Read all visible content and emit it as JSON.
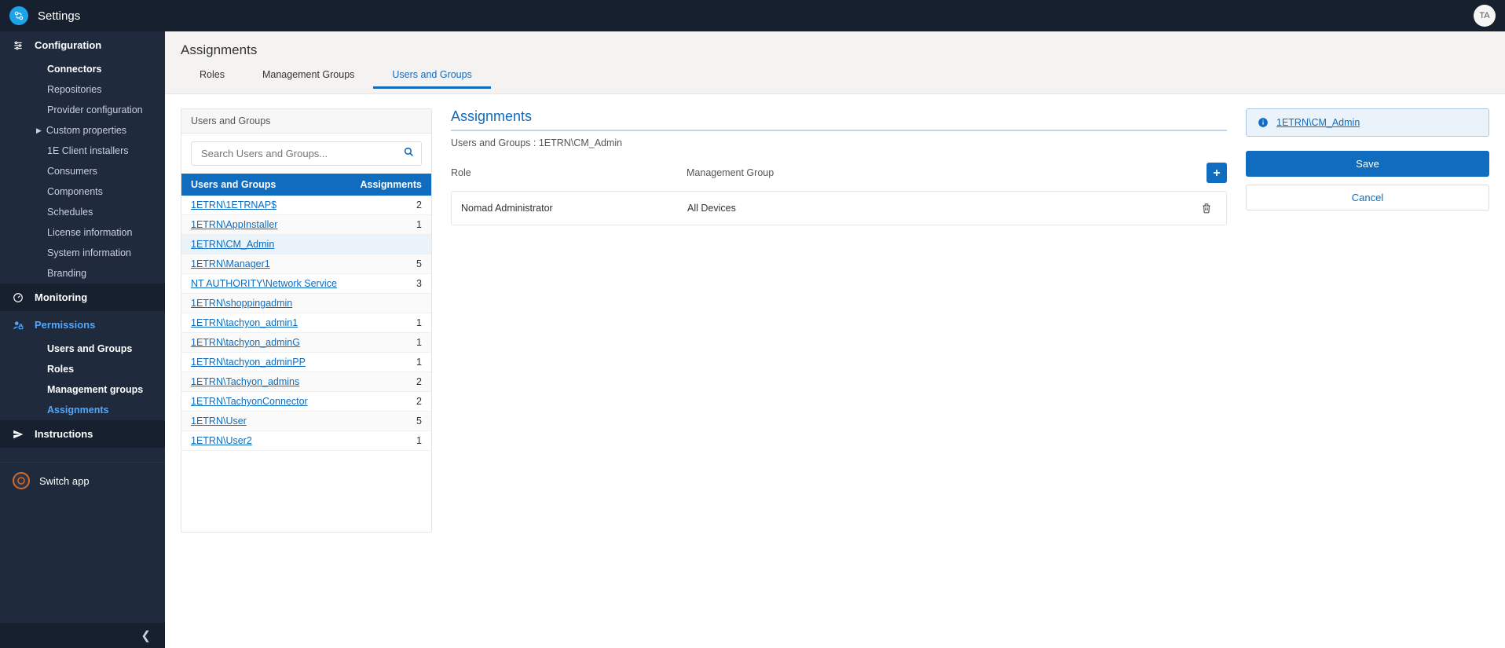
{
  "header": {
    "title": "Settings",
    "avatar": "TA"
  },
  "sidebar": {
    "configuration": {
      "label": "Configuration",
      "items": [
        {
          "label": "Connectors",
          "bold": true
        },
        {
          "label": "Repositories"
        },
        {
          "label": "Provider configuration"
        },
        {
          "label": "Custom properties",
          "caret": true
        },
        {
          "label": "1E Client installers"
        },
        {
          "label": "Consumers"
        },
        {
          "label": "Components"
        },
        {
          "label": "Schedules"
        },
        {
          "label": "License information"
        },
        {
          "label": "System information"
        },
        {
          "label": "Branding"
        }
      ]
    },
    "monitoring": {
      "label": "Monitoring"
    },
    "permissions": {
      "label": "Permissions",
      "items": [
        {
          "label": "Users and Groups",
          "bold": true
        },
        {
          "label": "Roles",
          "bold": true
        },
        {
          "label": "Management groups",
          "bold": true
        },
        {
          "label": "Assignments",
          "active": true
        }
      ]
    },
    "instructions": {
      "label": "Instructions"
    },
    "switch_app": "Switch app"
  },
  "page": {
    "title": "Assignments",
    "tabs": [
      {
        "label": "Roles"
      },
      {
        "label": "Management Groups"
      },
      {
        "label": "Users and Groups",
        "active": true
      }
    ]
  },
  "left_panel": {
    "title": "Users and Groups",
    "search_placeholder": "Search Users and Groups...",
    "columns": {
      "name": "Users and Groups",
      "count": "Assignments"
    },
    "rows": [
      {
        "name": "1ETRN\\1ETRNAP$",
        "count": "2"
      },
      {
        "name": "1ETRN\\AppInstaller",
        "count": "1"
      },
      {
        "name": "1ETRN\\CM_Admin",
        "count": "",
        "selected": true
      },
      {
        "name": "1ETRN\\Manager1",
        "count": "5"
      },
      {
        "name": "NT AUTHORITY\\Network Service",
        "count": "3"
      },
      {
        "name": "1ETRN\\shoppingadmin",
        "count": ""
      },
      {
        "name": "1ETRN\\tachyon_admin1",
        "count": "1"
      },
      {
        "name": "1ETRN\\tachyon_adminG",
        "count": "1"
      },
      {
        "name": "1ETRN\\tachyon_adminPP",
        "count": "1"
      },
      {
        "name": "1ETRN\\Tachyon_admins",
        "count": "2"
      },
      {
        "name": "1ETRN\\TachyonConnector",
        "count": "2"
      },
      {
        "name": "1ETRN\\User",
        "count": "5"
      },
      {
        "name": "1ETRN\\User2",
        "count": "1"
      }
    ]
  },
  "mid_panel": {
    "title": "Assignments",
    "subtitle": "Users and Groups : 1ETRN\\CM_Admin",
    "columns": {
      "role": "Role",
      "group": "Management Group"
    },
    "rows": [
      {
        "role": "Nomad Administrator",
        "group": "All Devices"
      }
    ]
  },
  "right_panel": {
    "info_link": "1ETRN\\CM_Admin",
    "save": "Save",
    "cancel": "Cancel"
  }
}
